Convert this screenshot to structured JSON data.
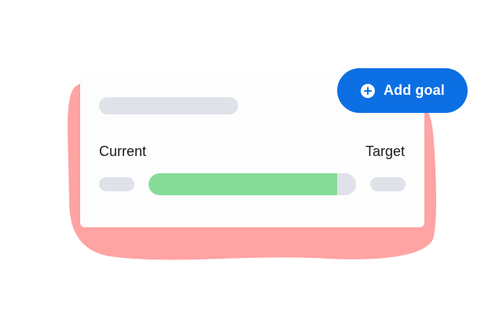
{
  "goal_card": {
    "current_label": "Current",
    "target_label": "Target",
    "progress_fraction": 0.91
  },
  "add_goal_button": {
    "label": "Add goal",
    "icon": "plus-circle-icon"
  },
  "colors": {
    "accent_blue": "#0c6fe3",
    "progress_green": "#85dc98",
    "highlight_red": "#ffa3a3",
    "skeleton_gray": "#dfe2e8"
  }
}
